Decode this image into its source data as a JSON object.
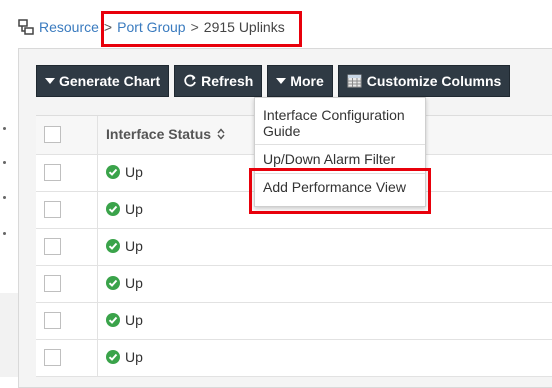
{
  "breadcrumb": {
    "root": "Resource",
    "sep1": ">",
    "middle": "Port Group",
    "sep2": ">",
    "current": "2915 Uplinks"
  },
  "toolbar": {
    "generate_chart": "Generate Chart",
    "refresh": "Refresh",
    "more": "More",
    "customize_columns": "Customize Columns"
  },
  "table": {
    "header": {
      "interface_status": "Interface Status"
    },
    "rows": [
      {
        "status": "Up"
      },
      {
        "status": "Up"
      },
      {
        "status": "Up"
      },
      {
        "status": "Up"
      },
      {
        "status": "Up"
      },
      {
        "status": "Up"
      }
    ]
  },
  "more_menu": {
    "items": [
      {
        "label": "Interface Configuration Guide"
      },
      {
        "label": "Up/Down Alarm Filter"
      },
      {
        "label": "Add Performance View"
      }
    ]
  },
  "colors": {
    "highlight": "#e8000b",
    "toolbar_bg": "#2f3a44",
    "link": "#3a7bbf",
    "status_up": "#3aa34a"
  },
  "icons": {
    "breadcrumb": "sitemap-icon",
    "generate_chart": "caret-down-icon",
    "refresh": "refresh-icon",
    "more": "caret-down-icon",
    "customize_columns": "columns-icon",
    "sort": "sort-icon",
    "status_up": "check-circle-icon"
  }
}
